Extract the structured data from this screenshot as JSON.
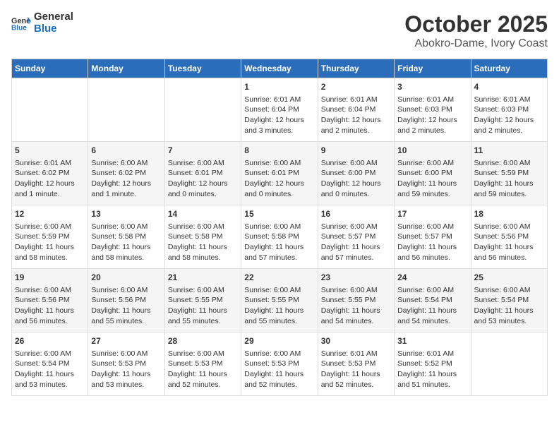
{
  "logo": {
    "text_general": "General",
    "text_blue": "Blue"
  },
  "header": {
    "month": "October 2025",
    "location": "Abokro-Dame, Ivory Coast"
  },
  "weekdays": [
    "Sunday",
    "Monday",
    "Tuesday",
    "Wednesday",
    "Thursday",
    "Friday",
    "Saturday"
  ],
  "weeks": [
    [
      {
        "day": "",
        "info": ""
      },
      {
        "day": "",
        "info": ""
      },
      {
        "day": "",
        "info": ""
      },
      {
        "day": "1",
        "info": "Sunrise: 6:01 AM\nSunset: 6:04 PM\nDaylight: 12 hours and 3 minutes."
      },
      {
        "day": "2",
        "info": "Sunrise: 6:01 AM\nSunset: 6:04 PM\nDaylight: 12 hours and 2 minutes."
      },
      {
        "day": "3",
        "info": "Sunrise: 6:01 AM\nSunset: 6:03 PM\nDaylight: 12 hours and 2 minutes."
      },
      {
        "day": "4",
        "info": "Sunrise: 6:01 AM\nSunset: 6:03 PM\nDaylight: 12 hours and 2 minutes."
      }
    ],
    [
      {
        "day": "5",
        "info": "Sunrise: 6:01 AM\nSunset: 6:02 PM\nDaylight: 12 hours and 1 minute."
      },
      {
        "day": "6",
        "info": "Sunrise: 6:00 AM\nSunset: 6:02 PM\nDaylight: 12 hours and 1 minute."
      },
      {
        "day": "7",
        "info": "Sunrise: 6:00 AM\nSunset: 6:01 PM\nDaylight: 12 hours and 0 minutes."
      },
      {
        "day": "8",
        "info": "Sunrise: 6:00 AM\nSunset: 6:01 PM\nDaylight: 12 hours and 0 minutes."
      },
      {
        "day": "9",
        "info": "Sunrise: 6:00 AM\nSunset: 6:00 PM\nDaylight: 12 hours and 0 minutes."
      },
      {
        "day": "10",
        "info": "Sunrise: 6:00 AM\nSunset: 6:00 PM\nDaylight: 11 hours and 59 minutes."
      },
      {
        "day": "11",
        "info": "Sunrise: 6:00 AM\nSunset: 5:59 PM\nDaylight: 11 hours and 59 minutes."
      }
    ],
    [
      {
        "day": "12",
        "info": "Sunrise: 6:00 AM\nSunset: 5:59 PM\nDaylight: 11 hours and 58 minutes."
      },
      {
        "day": "13",
        "info": "Sunrise: 6:00 AM\nSunset: 5:58 PM\nDaylight: 11 hours and 58 minutes."
      },
      {
        "day": "14",
        "info": "Sunrise: 6:00 AM\nSunset: 5:58 PM\nDaylight: 11 hours and 58 minutes."
      },
      {
        "day": "15",
        "info": "Sunrise: 6:00 AM\nSunset: 5:58 PM\nDaylight: 11 hours and 57 minutes."
      },
      {
        "day": "16",
        "info": "Sunrise: 6:00 AM\nSunset: 5:57 PM\nDaylight: 11 hours and 57 minutes."
      },
      {
        "day": "17",
        "info": "Sunrise: 6:00 AM\nSunset: 5:57 PM\nDaylight: 11 hours and 56 minutes."
      },
      {
        "day": "18",
        "info": "Sunrise: 6:00 AM\nSunset: 5:56 PM\nDaylight: 11 hours and 56 minutes."
      }
    ],
    [
      {
        "day": "19",
        "info": "Sunrise: 6:00 AM\nSunset: 5:56 PM\nDaylight: 11 hours and 56 minutes."
      },
      {
        "day": "20",
        "info": "Sunrise: 6:00 AM\nSunset: 5:56 PM\nDaylight: 11 hours and 55 minutes."
      },
      {
        "day": "21",
        "info": "Sunrise: 6:00 AM\nSunset: 5:55 PM\nDaylight: 11 hours and 55 minutes."
      },
      {
        "day": "22",
        "info": "Sunrise: 6:00 AM\nSunset: 5:55 PM\nDaylight: 11 hours and 55 minutes."
      },
      {
        "day": "23",
        "info": "Sunrise: 6:00 AM\nSunset: 5:55 PM\nDaylight: 11 hours and 54 minutes."
      },
      {
        "day": "24",
        "info": "Sunrise: 6:00 AM\nSunset: 5:54 PM\nDaylight: 11 hours and 54 minutes."
      },
      {
        "day": "25",
        "info": "Sunrise: 6:00 AM\nSunset: 5:54 PM\nDaylight: 11 hours and 53 minutes."
      }
    ],
    [
      {
        "day": "26",
        "info": "Sunrise: 6:00 AM\nSunset: 5:54 PM\nDaylight: 11 hours and 53 minutes."
      },
      {
        "day": "27",
        "info": "Sunrise: 6:00 AM\nSunset: 5:53 PM\nDaylight: 11 hours and 53 minutes."
      },
      {
        "day": "28",
        "info": "Sunrise: 6:00 AM\nSunset: 5:53 PM\nDaylight: 11 hours and 52 minutes."
      },
      {
        "day": "29",
        "info": "Sunrise: 6:00 AM\nSunset: 5:53 PM\nDaylight: 11 hours and 52 minutes."
      },
      {
        "day": "30",
        "info": "Sunrise: 6:01 AM\nSunset: 5:53 PM\nDaylight: 11 hours and 52 minutes."
      },
      {
        "day": "31",
        "info": "Sunrise: 6:01 AM\nSunset: 5:52 PM\nDaylight: 11 hours and 51 minutes."
      },
      {
        "day": "",
        "info": ""
      }
    ]
  ]
}
